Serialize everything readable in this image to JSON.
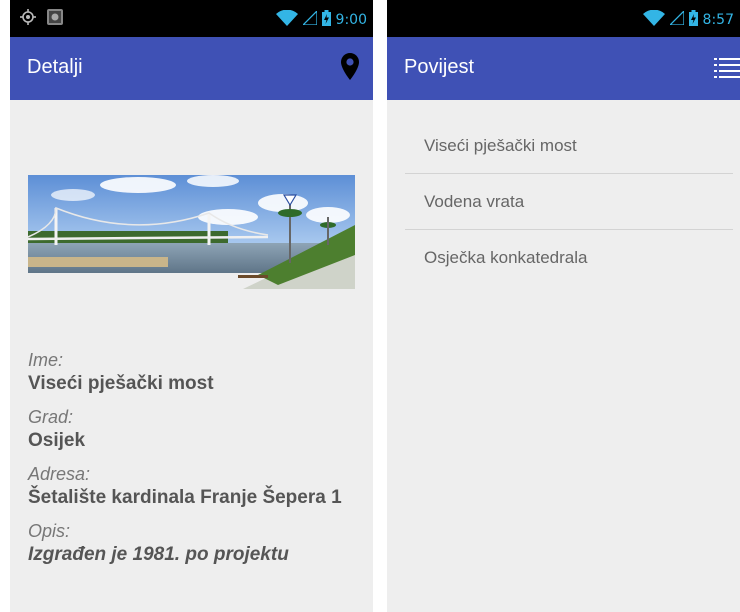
{
  "left_screen": {
    "status": {
      "time": "9:00"
    },
    "appbar": {
      "title": "Detalji",
      "action_icon": "map-marker-icon"
    },
    "photo": {
      "subject": "suspension footbridge over river"
    },
    "fields": [
      {
        "label": "Ime:",
        "value": "Viseći pješački most"
      },
      {
        "label": "Grad:",
        "value": "Osijek"
      },
      {
        "label": "Adresa:",
        "value": "Šetalište kardinala Franje Šepera 1"
      },
      {
        "label": "Opis:",
        "value": "Izgrađen je 1981. po projektu"
      }
    ]
  },
  "right_screen": {
    "status": {
      "time": "8:57"
    },
    "appbar": {
      "title": "Povijest",
      "action_icon": "menu-list-icon"
    },
    "list": [
      "Viseći pješački most",
      "Vodena vrata",
      "Osječka konkatedrala"
    ]
  },
  "colors": {
    "appbar": "#3f51b5",
    "statusbar": "#000000",
    "status_icons": "#33b5e5",
    "background": "#eeeeee"
  }
}
